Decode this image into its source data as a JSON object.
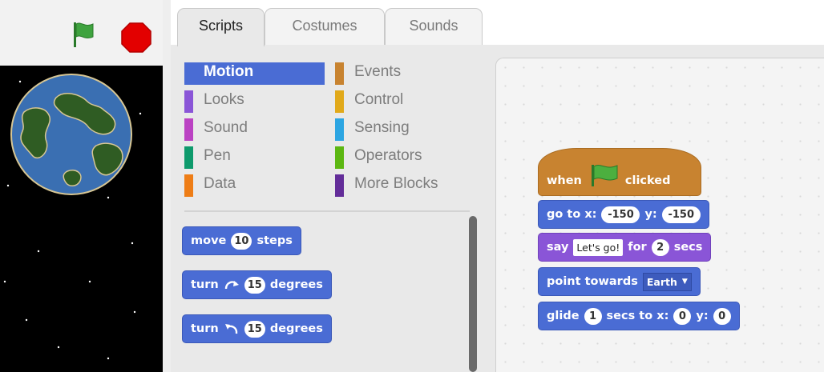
{
  "tabs": [
    "Scripts",
    "Costumes",
    "Sounds"
  ],
  "categories": [
    {
      "label": "Motion",
      "color": "#4a6cd4",
      "selected": true
    },
    {
      "label": "Looks",
      "color": "#8a55d7"
    },
    {
      "label": "Sound",
      "color": "#bb42c3"
    },
    {
      "label": "Pen",
      "color": "#0e9a6c"
    },
    {
      "label": "Data",
      "color": "#ee7d16"
    },
    {
      "label": "Events",
      "color": "#c88330"
    },
    {
      "label": "Control",
      "color": "#e1a91a"
    },
    {
      "label": "Sensing",
      "color": "#2ca5e2"
    },
    {
      "label": "Operators",
      "color": "#5cb712"
    },
    {
      "label": "More Blocks",
      "color": "#632d99"
    }
  ],
  "palette_blocks": {
    "move": {
      "word": "move",
      "steps": "10",
      "unit": "steps"
    },
    "turn_right": {
      "word": "turn",
      "degrees": "15",
      "unit": "degrees"
    },
    "turn_left": {
      "word": "turn",
      "degrees": "15",
      "unit": "degrees"
    }
  },
  "script": {
    "hat": {
      "when": "when",
      "clicked": "clicked",
      "icon": "green-flag-icon"
    },
    "goto": {
      "label": "go to x:",
      "x": "-150",
      "ylabel": "y:",
      "y": "-150"
    },
    "say": {
      "label": "say",
      "message": "Let's go!",
      "for": "for",
      "secs_value": "2",
      "secs": "secs"
    },
    "point": {
      "label": "point towards",
      "target": "Earth"
    },
    "glide": {
      "label": "glide",
      "secs_value": "1",
      "secs_to": "secs to x:",
      "x": "0",
      "ylabel": "y:",
      "y": "0"
    }
  },
  "stage": {
    "sprite": "Earth",
    "background": "#000000"
  },
  "colors": {
    "motion": "#4a6cd4",
    "looks": "#8a55d7",
    "events": "#c88330",
    "flag": "#2b9a2b",
    "stop": "#e00000"
  }
}
